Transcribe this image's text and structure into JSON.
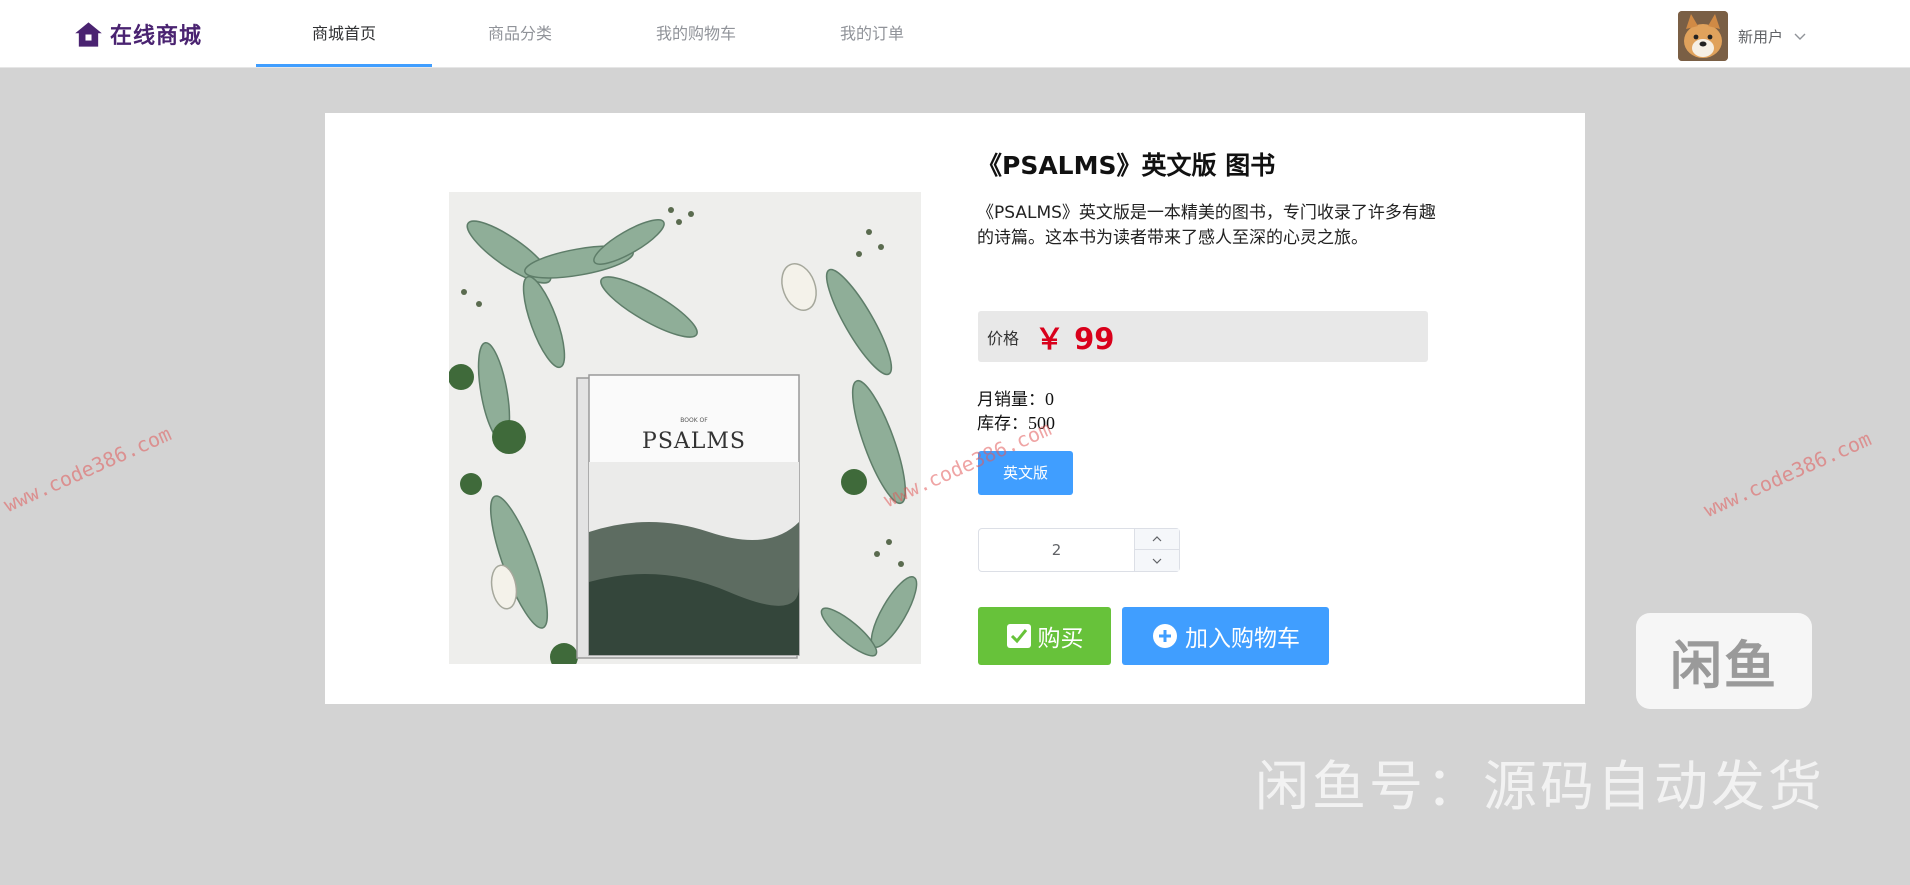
{
  "header": {
    "logo_text": "在线商城",
    "nav": [
      {
        "label": "商城首页",
        "active": true
      },
      {
        "label": "商品分类",
        "active": false
      },
      {
        "label": "我的购物车",
        "active": false
      },
      {
        "label": "我的订单",
        "active": false
      }
    ],
    "user_name": "新用户"
  },
  "product": {
    "title": "《PSALMS》英文版 图书",
    "description": "《PSALMS》英文版是一本精美的图书，专门收录了许多有趣的诗篇。这本书为读者带来了感人至深的心灵之旅。",
    "price_label": "价格",
    "price": "￥ 99",
    "monthly_sales_label": "月销量：",
    "monthly_sales": "0",
    "stock_label": "库存：",
    "stock": "500",
    "variant": "英文版",
    "quantity": "2",
    "book_cover_small": "BOOK OF",
    "book_cover_title": "PSALMS"
  },
  "actions": {
    "buy": "购买",
    "add_to_cart": "加入购物车"
  },
  "watermarks": {
    "url": "www.code386.com",
    "badge": "闲鱼",
    "xianyu": "闲鱼号：源码自动发货"
  },
  "colors": {
    "primary": "#409eff",
    "success": "#67c23a",
    "price": "#d9001b",
    "logo": "#4a2371"
  }
}
